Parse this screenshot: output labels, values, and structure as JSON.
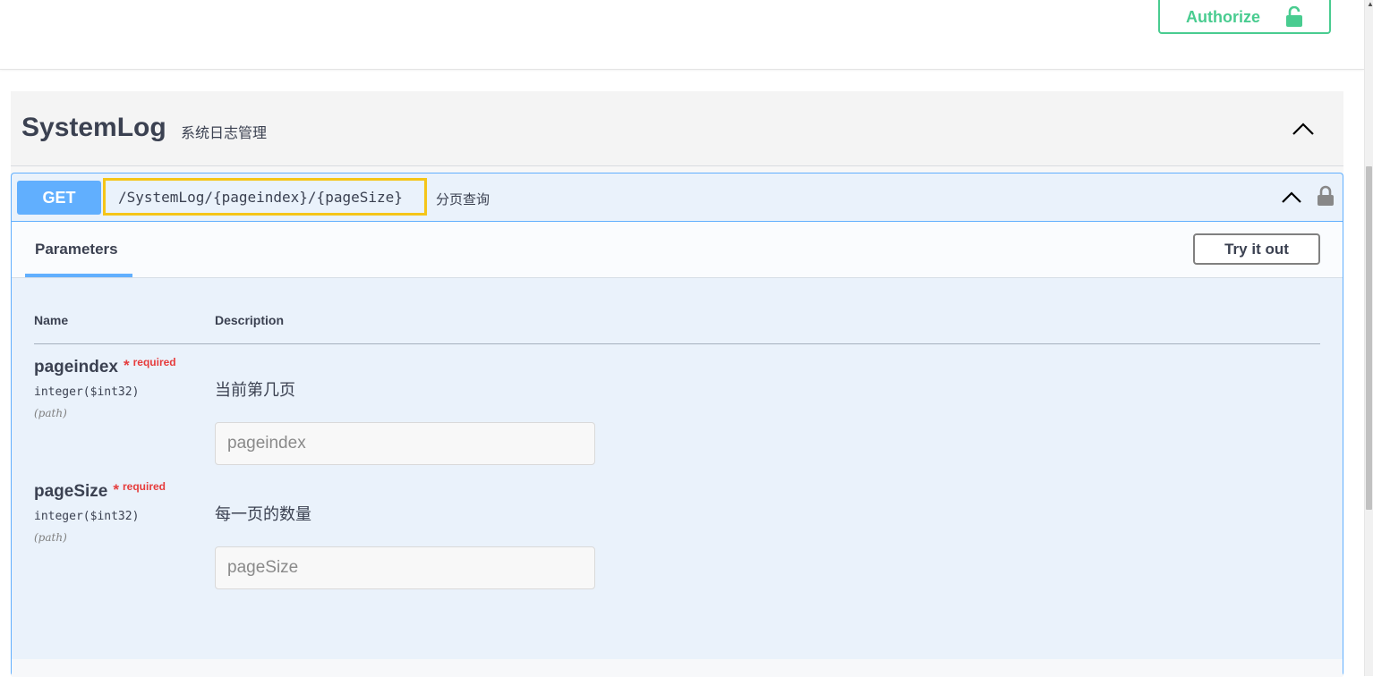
{
  "header": {
    "authorize_label": "Authorize",
    "authorize_icon": "unlock-icon",
    "accent_color": "#49cc90"
  },
  "tag": {
    "name": "SystemLog",
    "description": "系统日志管理"
  },
  "operation": {
    "method": "GET",
    "path": "/SystemLog/{pageindex}/{pageSize}",
    "summary": "分页查询",
    "method_color": "#61affe",
    "highlight_color": "#f5c518"
  },
  "parameters": {
    "tab_label": "Parameters",
    "try_label": "Try it out",
    "col_name": "Name",
    "col_description": "Description",
    "items": [
      {
        "name": "pageindex",
        "star": "*",
        "required": "required",
        "type": "integer($int32)",
        "in": "(path)",
        "description": "当前第几页",
        "placeholder": "pageindex"
      },
      {
        "name": "pageSize",
        "star": "*",
        "required": "required",
        "type": "integer($int32)",
        "in": "(path)",
        "description": "每一页的数量",
        "placeholder": "pageSize"
      }
    ]
  }
}
